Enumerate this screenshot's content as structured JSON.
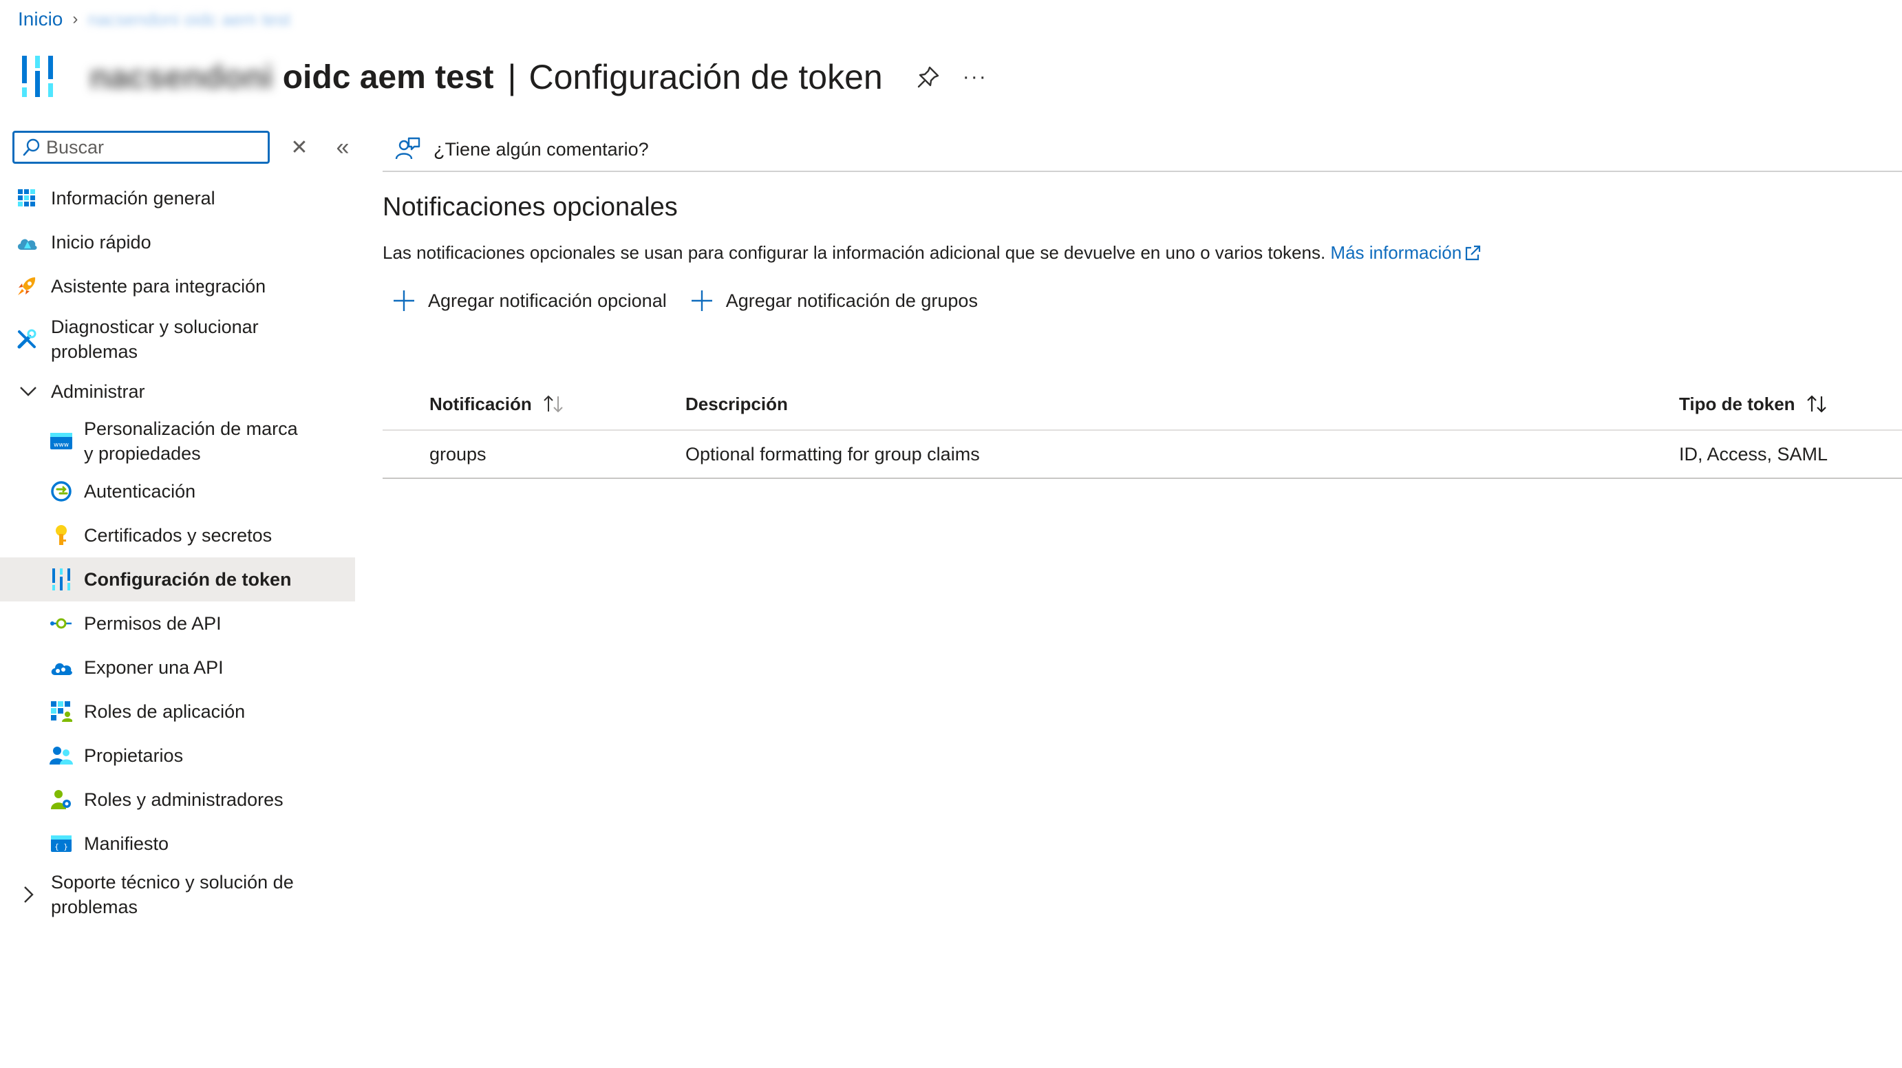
{
  "breadcrumb": {
    "home": "Inicio",
    "current": "nacsendoni oidc aem test"
  },
  "header": {
    "title_blurred": "nacsendoni",
    "title_app": "oidc aem test",
    "separator": "|",
    "page_title": "Configuración de token",
    "more_label": "···"
  },
  "search": {
    "placeholder": "Buscar",
    "value": "",
    "clear_label": "✕",
    "collapse_label": "«"
  },
  "sidebar": {
    "items": [
      {
        "label": "Información general"
      },
      {
        "label": "Inicio rápido"
      },
      {
        "label": "Asistente para integración"
      },
      {
        "label": "Diagnosticar y solucionar problemas"
      },
      {
        "label": "Administrar"
      },
      {
        "label": "Personalización de marca y propiedades"
      },
      {
        "label": "Autenticación"
      },
      {
        "label": "Certificados y secretos"
      },
      {
        "label": "Configuración de token"
      },
      {
        "label": "Permisos de API"
      },
      {
        "label": "Exponer una API"
      },
      {
        "label": "Roles de aplicación"
      },
      {
        "label": "Propietarios"
      },
      {
        "label": "Roles y administradores"
      },
      {
        "label": "Manifiesto"
      },
      {
        "label": "Soporte técnico y solución de problemas"
      }
    ]
  },
  "toolbar": {
    "feedback_label": "¿Tiene algún comentario?"
  },
  "main": {
    "section_title": "Notificaciones opcionales",
    "description": "Las notificaciones opcionales se usan para configurar la información adicional que se devuelve en uno o varios tokens.",
    "more_info_link": "Más información",
    "actions": {
      "add_optional": "Agregar notificación opcional",
      "add_groups": "Agregar notificación de grupos"
    },
    "table": {
      "headers": {
        "claim": "Notificación",
        "description": "Descripción",
        "token_type": "Tipo de token"
      },
      "rows": [
        {
          "claim": "groups",
          "description": "Optional formatting for group claims",
          "token_type": "ID, Access, SAML"
        }
      ]
    }
  },
  "colors": {
    "accent": "#0f6cbd",
    "active_bg": "#edebe9",
    "text": "#201f1e"
  }
}
